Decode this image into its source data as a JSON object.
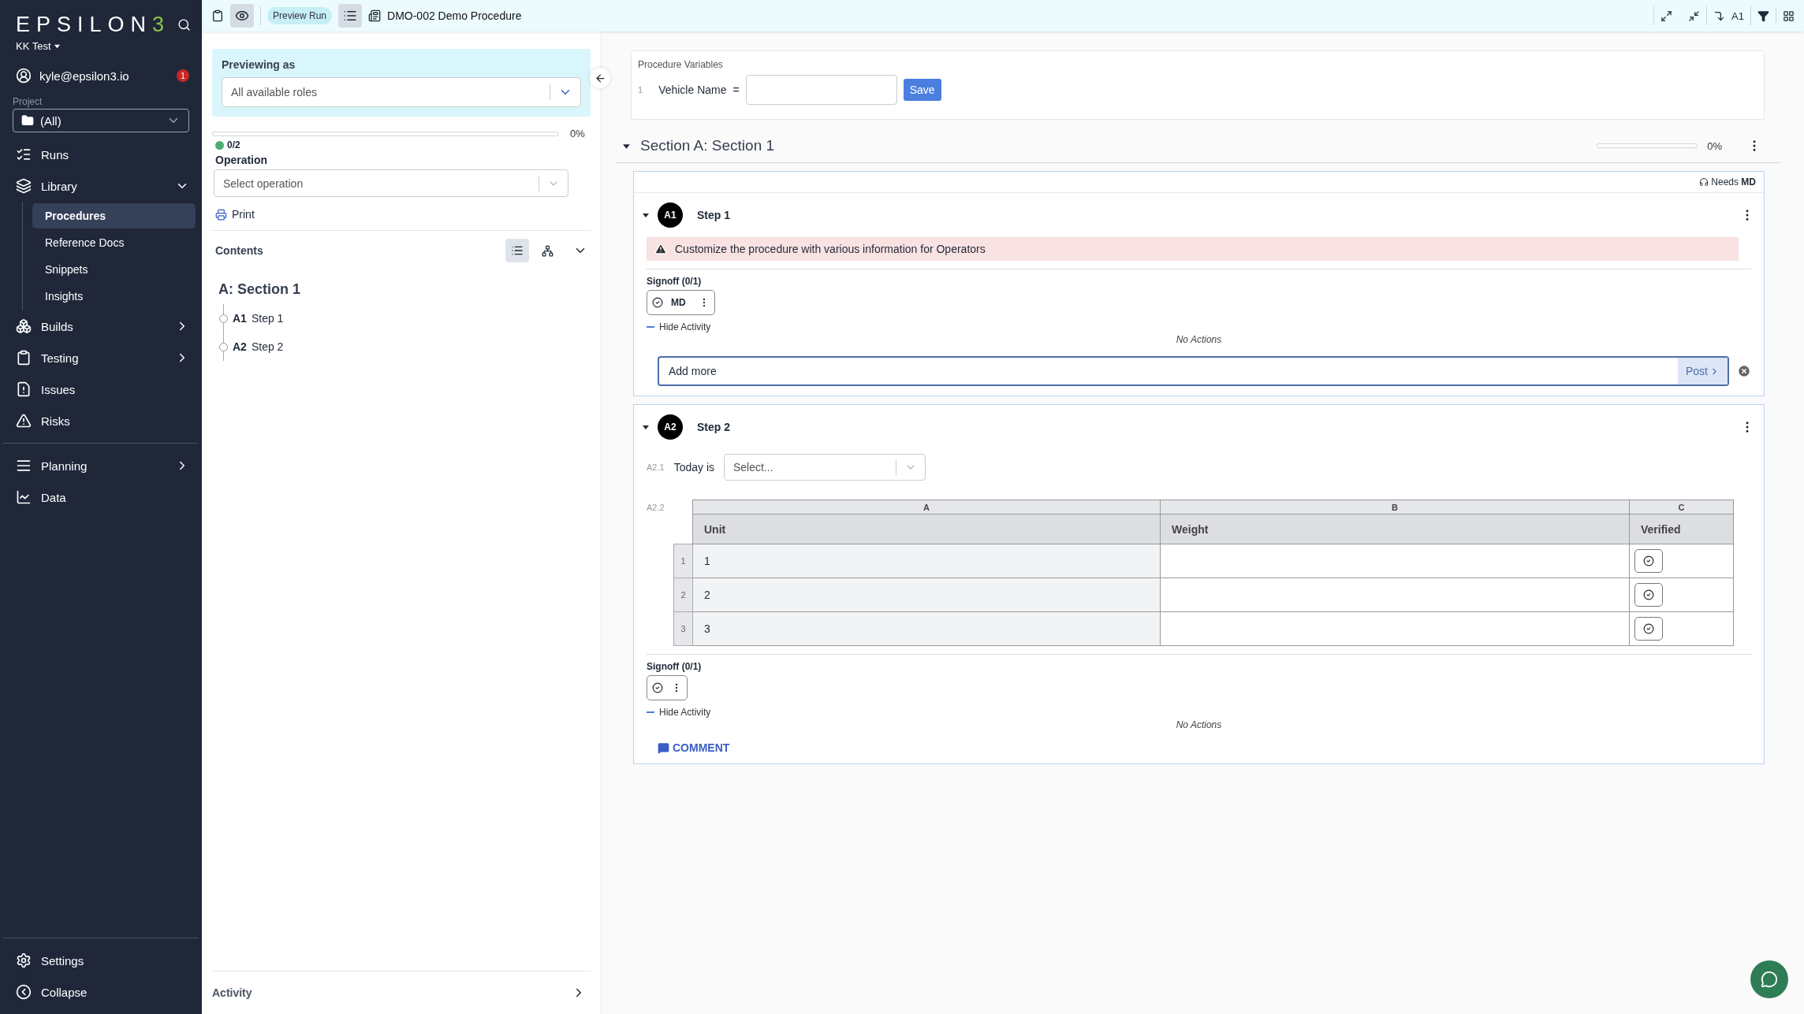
{
  "topbar": {
    "preview_selected": true,
    "mode_badge": "Preview Run",
    "list_selected": true,
    "title": "DMO-002 Demo Procedure",
    "jump_label": "A1"
  },
  "sidebar": {
    "logo": {
      "text": "EPSILON",
      "accent": "3"
    },
    "workspace": "KK Test",
    "user": "kyle@epsilon3.io",
    "notifications": "1",
    "project_label": "Project",
    "project_value": "(All)",
    "nav_top": [
      {
        "kind": "link",
        "label": "Runs"
      },
      {
        "kind": "group",
        "label": "Library",
        "expanded": true,
        "children": [
          {
            "label": "Procedures",
            "selected": true
          },
          {
            "label": "Reference Docs",
            "selected": false
          },
          {
            "label": "Snippets",
            "selected": false
          },
          {
            "label": "Insights",
            "selected": false
          }
        ]
      },
      {
        "kind": "group",
        "label": "Builds",
        "expanded": false
      },
      {
        "kind": "group",
        "label": "Testing",
        "expanded": false
      },
      {
        "kind": "link",
        "label": "Issues"
      },
      {
        "kind": "link",
        "label": "Risks"
      }
    ],
    "nav_bottom": [
      {
        "kind": "group",
        "label": "Planning",
        "expanded": false
      },
      {
        "kind": "link",
        "label": "Data"
      }
    ],
    "footer": [
      {
        "label": "Settings"
      },
      {
        "label": "Collapse"
      }
    ]
  },
  "panel": {
    "previewing": {
      "label": "Previewing as",
      "value": "All available roles"
    },
    "progress": {
      "level": 0,
      "reading": "0%"
    },
    "count": {
      "color": "#4caf72",
      "text": "0/2"
    },
    "operation": {
      "label": "Operation",
      "placeholder": "Select operation"
    },
    "print": "Print",
    "contents": {
      "title": "Contents",
      "list_view_selected": true,
      "expanded": true,
      "items": [
        {
          "title": "A: Section 1",
          "children": [
            {
              "id": "A1",
              "label": "Step 1"
            },
            {
              "id": "A2",
              "label": "Step 2"
            }
          ]
        }
      ]
    },
    "activity": "Activity"
  },
  "main": {
    "variables": {
      "title": "Procedure Variables",
      "items": [
        {
          "index": "1",
          "name": "Vehicle Name",
          "sign": "=",
          "button": "Save"
        }
      ]
    },
    "sections": [
      {
        "title": "Section A: Section 1",
        "expanded": true,
        "progress": {
          "level": 0,
          "reading": "0%"
        },
        "steps": [
          {
            "badge": "A1",
            "title": "Step 1",
            "expanded": true,
            "needs": {
              "label": "Needs",
              "role": "MD"
            },
            "blocks": [
              {
                "kind": "warning",
                "text": "Customize the procedure with various information for Operators"
              }
            ],
            "signoff": {
              "title": "Signoff (0/1)",
              "role": "MD"
            },
            "activity_toggle": "Hide Activity",
            "activity_empty": "No Actions",
            "comment": {
              "kind": "input",
              "value": "Add more",
              "button": "Post"
            }
          },
          {
            "badge": "A2",
            "title": "Step 2",
            "expanded": true,
            "blocks": [
              {
                "kind": "select",
                "index": "A2.1",
                "label": "Today is",
                "placeholder": "Select..."
              },
              {
                "kind": "table",
                "index": "A2.2",
                "letters": [
                  "A",
                  "B",
                  "C"
                ],
                "headers": [
                  "Unit",
                  "Weight",
                  "Verified"
                ],
                "rows": [
                  {
                    "number": "1",
                    "unit": "1",
                    "verified": false
                  },
                  {
                    "number": "2",
                    "unit": "2",
                    "verified": false
                  },
                  {
                    "number": "3",
                    "unit": "3",
                    "verified": false
                  }
                ]
              }
            ],
            "signoff": {
              "title": "Signoff (0/1)"
            },
            "activity_toggle": "Hide Activity",
            "activity_empty": "No Actions",
            "comment": {
              "kind": "button",
              "label": "COMMENT"
            }
          }
        ]
      }
    ]
  }
}
